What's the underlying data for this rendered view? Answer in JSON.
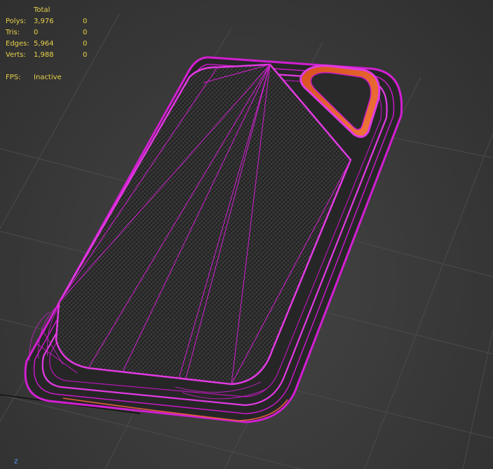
{
  "viewport": {
    "background": "#3a3a3a",
    "grid_color": "#4b4b4b",
    "wire_color": "#d21fd2",
    "highlight_color": "#e0603a",
    "surface_color": "#2b2b2b"
  },
  "stats": {
    "header": "Total",
    "rows": [
      {
        "label": "Polys:",
        "value": "3,976",
        "selected": "0"
      },
      {
        "label": "Tris:",
        "value": "0",
        "selected": "0"
      },
      {
        "label": "Edges:",
        "value": "5,964",
        "selected": "0"
      },
      {
        "label": "Verts:",
        "value": "1,988",
        "selected": "0"
      }
    ],
    "fps_label": "FPS:",
    "fps_value": "Inactive"
  },
  "gizmo": {
    "axis_label": "Z"
  }
}
